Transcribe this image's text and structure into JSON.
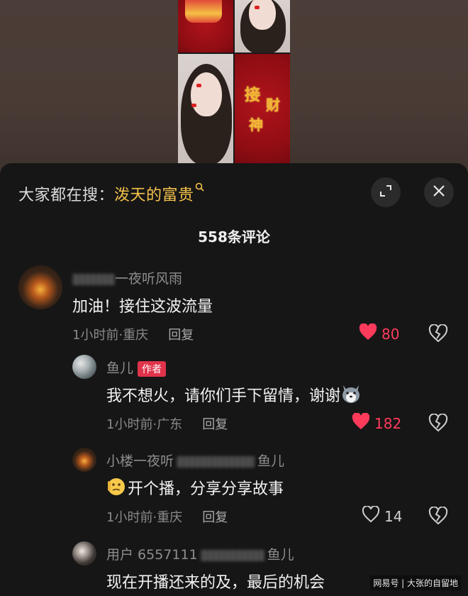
{
  "video": {
    "poster_chars": [
      "接",
      "财",
      "神"
    ]
  },
  "header": {
    "search_prefix": "大家都在搜：",
    "search_keyword": "泼天的富贵",
    "comment_count_title": "558条评论"
  },
  "icons": {
    "expand": "expand-icon",
    "close": "close-icon",
    "search": "search-icon",
    "like": "heart-icon",
    "dislike": "broken-heart-icon"
  },
  "colors": {
    "accent_keyword": "#f5c34b",
    "like_active": "#ff3b5c",
    "author_badge": "#e0334b"
  },
  "comments": [
    {
      "username_visible": "一夜听风雨",
      "text": "加油！接住这波流量",
      "time": "1小时前",
      "location": "重庆",
      "reply_label": "回复",
      "likes": "80",
      "liked": true
    },
    {
      "username_visible": "鱼儿",
      "badge": "作者",
      "text": "我不想火，请你们手下留情，谢谢",
      "time": "1小时前",
      "location": "广东",
      "reply_label": "回复",
      "likes": "182",
      "liked": true
    },
    {
      "username_visible": "小楼一夜听",
      "username_tail": "鱼儿",
      "text": "开个播，分享分享故事",
      "time": "1小时前",
      "location": "重庆",
      "reply_label": "回复",
      "likes": "14",
      "liked": false
    },
    {
      "username_visible": "用户 6557111",
      "username_tail": "鱼儿",
      "text": "现在开播还来的及，最后的机会"
    }
  ],
  "watermark": "网易号 | 大张的自留地"
}
